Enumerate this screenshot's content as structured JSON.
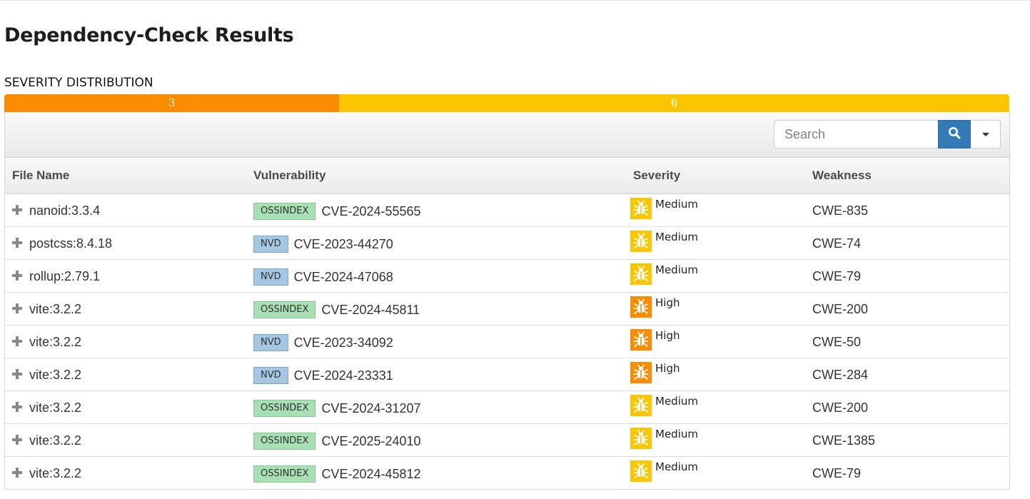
{
  "page": {
    "title": "Dependency-Check Results"
  },
  "severity_distribution": {
    "title": "SEVERITY DISTRIBUTION",
    "segments": [
      {
        "label": "3",
        "count": 3,
        "severity": "High",
        "color": "#fb8c00"
      },
      {
        "label": "6",
        "count": 6,
        "severity": "Medium",
        "color": "#fbc500"
      }
    ]
  },
  "search": {
    "placeholder": "Search",
    "icon": "search-icon",
    "dropdown_icon": "caret-down-icon"
  },
  "table": {
    "headers": {
      "file": "File Name",
      "vulnerability": "Vulnerability",
      "severity": "Severity",
      "weakness": "Weakness"
    },
    "rows": [
      {
        "file": "nanoid:3.3.4",
        "source": "OSSINDEX",
        "cve": "CVE-2024-55565",
        "severity": "Medium",
        "weakness": "CWE-835"
      },
      {
        "file": "postcss:8.4.18",
        "source": "NVD",
        "cve": "CVE-2023-44270",
        "severity": "Medium",
        "weakness": "CWE-74"
      },
      {
        "file": "rollup:2.79.1",
        "source": "NVD",
        "cve": "CVE-2024-47068",
        "severity": "Medium",
        "weakness": "CWE-79"
      },
      {
        "file": "vite:3.2.2",
        "source": "OSSINDEX",
        "cve": "CVE-2024-45811",
        "severity": "High",
        "weakness": "CWE-200"
      },
      {
        "file": "vite:3.2.2",
        "source": "NVD",
        "cve": "CVE-2023-34092",
        "severity": "High",
        "weakness": "CWE-50"
      },
      {
        "file": "vite:3.2.2",
        "source": "NVD",
        "cve": "CVE-2024-23331",
        "severity": "High",
        "weakness": "CWE-284"
      },
      {
        "file": "vite:3.2.2",
        "source": "OSSINDEX",
        "cve": "CVE-2024-31207",
        "severity": "Medium",
        "weakness": "CWE-200"
      },
      {
        "file": "vite:3.2.2",
        "source": "OSSINDEX",
        "cve": "CVE-2025-24010",
        "severity": "Medium",
        "weakness": "CWE-1385"
      },
      {
        "file": "vite:3.2.2",
        "source": "OSSINDEX",
        "cve": "CVE-2024-45812",
        "severity": "Medium",
        "weakness": "CWE-79"
      }
    ]
  },
  "colors": {
    "high": "#fb8c00",
    "medium": "#fbc500",
    "search_button": "#337ab7",
    "ossindex_tag": "#a9dfb4",
    "nvd_tag": "#a6c7e2"
  },
  "icons": {
    "expand": "plus-icon",
    "severity": "bug-icon"
  }
}
